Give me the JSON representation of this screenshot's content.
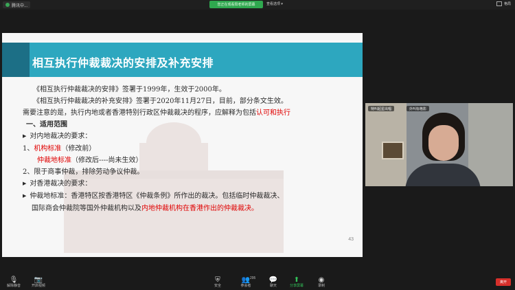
{
  "window": {
    "meeting_tab": "腾讯中...",
    "share_banner": "您正在观看阳老师的屏幕",
    "view_options": "查看选项 ▾",
    "view_toggle": "格局"
  },
  "slide": {
    "title": "相互执行仲裁裁决的安排及补充安排",
    "lines": {
      "l1": "《相互执行仲裁裁决的安排》签署于1999年，生效于2000年。",
      "l2": "《相互执行仲裁裁决的补充安排》签署于2020年11月27日，目前，部分条文生效。",
      "l3a": "需要注意的是，执行内地或者香港特别行政区仲裁裁决的程序，应解释为包括",
      "l3b": "认可和执行",
      "l4": "一、适用范围",
      "l5": "对内地裁决的要求：",
      "l6a": "1、",
      "l6b": "机构标准",
      "l6c": "（修改前）",
      "l7a": "仲裁地标准",
      "l7b": "（修改后----尚未生效）",
      "l8": "2、限于商事仲裁，排除劳动争议仲裁。",
      "l9": "对香港裁决的要求：",
      "l10": "仲裁地标准：香港特区按香港特区《仲裁条例》所作出的裁决。包括临时仲裁裁决、",
      "l11a": "国际商会仲裁院等国外仲裁机构以及",
      "l11b": "内地仲裁机构在香港作出的仲裁裁决。"
    },
    "page_number": "43"
  },
  "video": {
    "tag_left": "特叫起星出唱",
    "tag_right": "外叫标格影"
  },
  "toolbar": {
    "mute": "解除静音",
    "video": "开启视频",
    "security": "安全",
    "participants": "参会者",
    "participants_count": "295",
    "chat": "聊天",
    "share": "分享屏幕",
    "record": "录制",
    "end": "离开"
  },
  "colors": {
    "band": "#2da7bf",
    "highlight_red": "#e00000",
    "share_green": "#2fa84f",
    "end_red": "#d7302b"
  }
}
